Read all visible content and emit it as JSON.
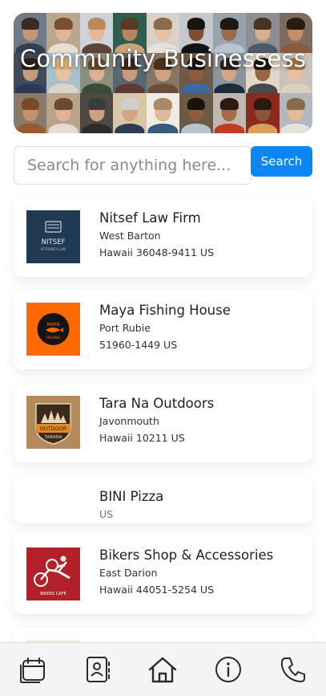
{
  "hero": {
    "title": "Community Businessess"
  },
  "search": {
    "placeholder": "Search for anything here...",
    "button_label": "Search"
  },
  "businesses": [
    {
      "name": "Nitsef Law Firm",
      "line1": "West Barton",
      "line2": "Hawaii 36048-9411 US",
      "logo": "nitsef-logo",
      "logo_text": "NITSEF",
      "logo_sub": "ATTORNEY LAW"
    },
    {
      "name": "Maya Fishing House",
      "line1": "Port Rubie",
      "line2": "51960-1449 US",
      "logo": "maya-fishing-logo",
      "logo_text": "MAYA",
      "logo_sub": "FISHING"
    },
    {
      "name": "Tara Na Outdoors",
      "line1": "Javonmouth",
      "line2": "Hawaii 10211 US",
      "logo": "tara-outdoors-logo",
      "logo_text": "OUTDOOR",
      "logo_sub": "TARANA"
    },
    {
      "name": "BINI Pizza",
      "line1": "US",
      "line2": "",
      "logo": ""
    },
    {
      "name": "Bikers Shop & Accessories",
      "line1": "East Darion",
      "line2": "Hawaii 44051-5254 US",
      "logo": "bikers-cafe-logo",
      "logo_text": "BIKERS CAFE",
      "logo_sub": ""
    }
  ],
  "nav": {
    "items": [
      {
        "icon": "calendar-icon"
      },
      {
        "icon": "contacts-icon"
      },
      {
        "icon": "home-icon"
      },
      {
        "icon": "info-icon"
      },
      {
        "icon": "phone-icon"
      }
    ]
  },
  "colors": {
    "accent": "#0d86f5",
    "nav_icon": "#2a2a2a",
    "nitsef_bg": "#1f3a52",
    "maya_bg": "#ff6a00",
    "tara_bg": "#b48a5a",
    "bikers_bg": "#b3202a"
  }
}
